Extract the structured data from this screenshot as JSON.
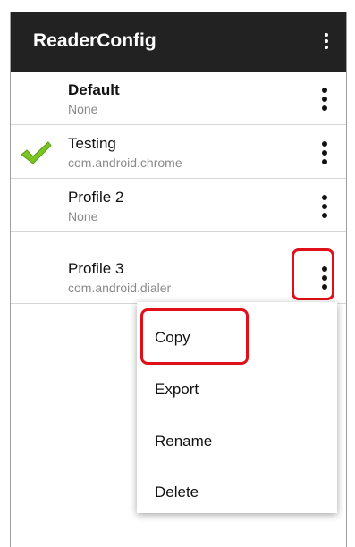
{
  "appbar": {
    "title": "ReaderConfig",
    "overflow_icon": "more-vert-icon"
  },
  "profiles": [
    {
      "name": "Default",
      "package": "None",
      "active": false,
      "bold": true
    },
    {
      "name": "Testing",
      "package": "com.android.chrome",
      "active": true,
      "bold": false
    },
    {
      "name": "Profile 2",
      "package": "None",
      "active": false,
      "bold": false
    },
    {
      "name": "Profile 3",
      "package": "com.android.dialer",
      "active": false,
      "bold": false
    }
  ],
  "context_menu": {
    "items": [
      "Copy",
      "Export",
      "Rename",
      "Delete"
    ]
  },
  "colors": {
    "appbar_bg": "#222222",
    "highlight": "#e0101a",
    "check_green": "#7cc324"
  }
}
